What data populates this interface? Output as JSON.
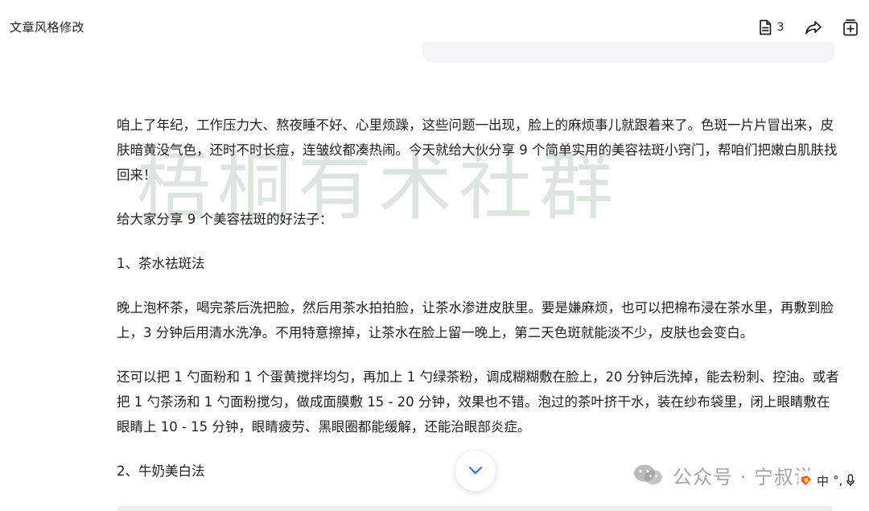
{
  "header": {
    "title": "文章风格修改",
    "doc_count": "3"
  },
  "icons": {
    "doc": "document-icon",
    "share": "share-icon",
    "add": "add-to-notebook-icon",
    "scroll": "chevron-down-icon"
  },
  "article": {
    "intro": "咱上了年纪，工作压力大、熬夜睡不好、心里烦躁，这些问题一出现，脸上的麻烦事儿就跟着来了。色斑一片片冒出来，皮肤暗黄没气色，还时不时长痘，连皱纹都凑热闹。今天就给大伙分享 9 个简单实用的美容祛斑小窍门，帮咱们把嫩白肌肤找回来！",
    "share_line": "给大家分享 9 个美容祛斑的好法子：",
    "heading1": "1、茶水祛斑法",
    "body1": "晚上泡杯茶，喝完茶后洗把脸，然后用茶水拍拍脸，让茶水渗进皮肤里。要是嫌麻烦，也可以把棉布浸在茶水里，再敷到脸上，3 分钟后用清水洗净。不用特意擦掉，让茶水在脸上留一晚上，第二天色斑就能淡不少，皮肤也会变白。",
    "body2": "还可以把 1 勺面粉和 1 个蛋黄搅拌均匀，再加上 1 勺绿茶粉，调成糊糊敷在脸上，20 分钟后洗掉，能去粉刺、控油。或者把 1 勺茶汤和 1 勺面粉搅匀，做成面膜敷 15 - 20 分钟，效果也不错。泡过的茶叶挤干水，装在纱布袋里，闭上眼睛敷在眼睛上 10 - 15 分钟，眼睛疲劳、黑眼圈都能缓解，还能治眼部炎症。",
    "heading2": "2、牛奶美白法"
  },
  "watermark": {
    "text": "梧桐有术社群"
  },
  "wechat_watermark": {
    "text": "公众号 · 宁叔说"
  },
  "ime": {
    "lang": "中",
    "punct": "°,"
  },
  "colors": {
    "text": "#1f1f1f",
    "watermark": "#96b298",
    "bubble": "#f4f5f7"
  }
}
